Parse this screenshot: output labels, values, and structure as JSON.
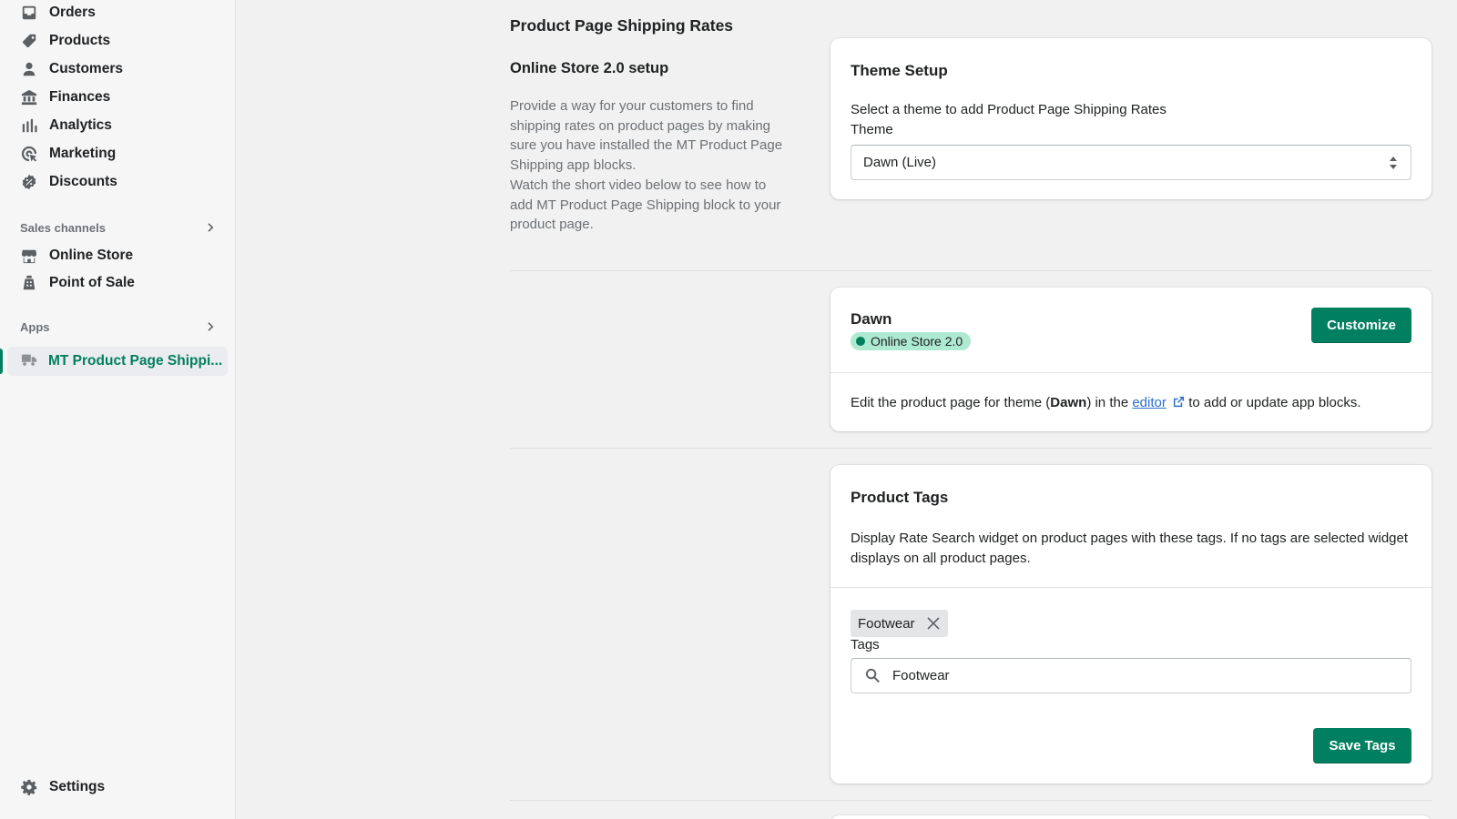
{
  "sidebar": {
    "items": [
      {
        "label": "Orders",
        "icon": "inbox-icon"
      },
      {
        "label": "Products",
        "icon": "tag-icon"
      },
      {
        "label": "Customers",
        "icon": "person-icon"
      },
      {
        "label": "Finances",
        "icon": "bank-icon"
      },
      {
        "label": "Analytics",
        "icon": "bar-chart-icon"
      },
      {
        "label": "Marketing",
        "icon": "target-icon"
      },
      {
        "label": "Discounts",
        "icon": "discount-icon"
      }
    ],
    "sales_channels": {
      "heading": "Sales channels",
      "items": [
        {
          "label": "Online Store",
          "icon": "store-icon"
        },
        {
          "label": "Point of Sale",
          "icon": "pos-icon"
        }
      ]
    },
    "apps": {
      "heading": "Apps",
      "items": [
        {
          "label": "MT Product Page Shippi...",
          "icon": "truck-icon",
          "active": true
        }
      ]
    },
    "settings_label": "Settings"
  },
  "main": {
    "page_title": "Product Page Shipping Rates",
    "section_title": "Online Store 2.0 setup",
    "section_desc": "Provide a way for your customers to find shipping rates on product pages by making sure you have installed the MT Product Page Shipping app blocks.\nWatch the short video below to see how to add MT Product Page Shipping block to your product page.",
    "theme_setup": {
      "title": "Theme Setup",
      "instruction": "Select a theme to add Product Page Shipping Rates",
      "field_label": "Theme",
      "selected": "Dawn (Live)"
    },
    "theme_card": {
      "name": "Dawn",
      "badge": "Online Store 2.0",
      "customize_label": "Customize",
      "edit_prefix": "Edit the product page for theme (",
      "edit_theme": "Dawn",
      "edit_mid": ") in the ",
      "edit_link": "editor",
      "edit_suffix": " to add or update app blocks."
    },
    "product_tags": {
      "title": "Product Tags",
      "desc": "Display Rate Search widget on product pages with these tags. If no tags are selected widget displays on all product pages.",
      "chips": [
        "Footwear"
      ],
      "field_label": "Tags",
      "search_value": "Footwear",
      "save_label": "Save Tags"
    }
  },
  "colors": {
    "accent": "#008060",
    "badge_bg": "#aee9d1",
    "link": "#2c6ecb"
  }
}
